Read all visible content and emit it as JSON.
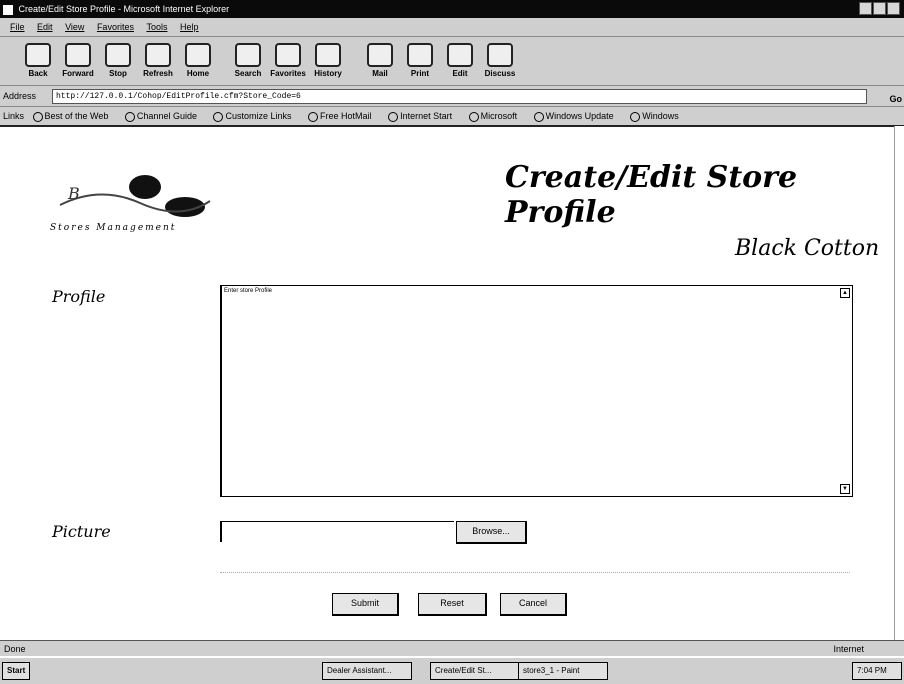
{
  "window": {
    "title": "Create/Edit Store Profile - Microsoft Internet Explorer"
  },
  "menu": [
    "File",
    "Edit",
    "View",
    "Favorites",
    "Tools",
    "Help"
  ],
  "toolbar": [
    {
      "label": "Back",
      "icon": "back-arrow-icon"
    },
    {
      "label": "Forward",
      "icon": "forward-arrow-icon"
    },
    {
      "label": "Stop",
      "icon": "stop-icon"
    },
    {
      "label": "Refresh",
      "icon": "refresh-icon"
    },
    {
      "label": "Home",
      "icon": "home-icon"
    },
    {
      "label": "Search",
      "icon": "search-icon"
    },
    {
      "label": "Favorites",
      "icon": "favorites-icon"
    },
    {
      "label": "History",
      "icon": "history-icon"
    },
    {
      "label": "Mail",
      "icon": "mail-icon"
    },
    {
      "label": "Print",
      "icon": "print-icon"
    },
    {
      "label": "Edit",
      "icon": "edit-icon"
    },
    {
      "label": "Discuss",
      "icon": "discuss-icon"
    }
  ],
  "address": {
    "label": "Address",
    "url": "http://127.0.0.1/Cohop/EditProfile.cfm?Store_Code=6",
    "go": "Go"
  },
  "links": {
    "label": "Links",
    "items": [
      "Best of the Web",
      "Channel Guide",
      "Customize Links",
      "Free HotMail",
      "Internet Start",
      "Microsoft",
      "Windows Update",
      "Windows"
    ]
  },
  "page": {
    "title": "Create/Edit Store Profile",
    "store_name": "Black Cotton",
    "logo_text": "Stores Management",
    "profile_label": "Profile",
    "profile_text": "Enter store Profile",
    "picture_label": "Picture",
    "browse_label": "Browse...",
    "submit_label": "Submit",
    "reset_label": "Reset",
    "cancel_label": "Cancel"
  },
  "status": {
    "left": "Done",
    "zone": "Internet"
  },
  "taskbar": {
    "start": "Start",
    "tasks": [
      "Dealer Assistant...",
      "Create/Edit St...",
      "store3_1 - Paint"
    ],
    "clock": "7:04 PM"
  }
}
